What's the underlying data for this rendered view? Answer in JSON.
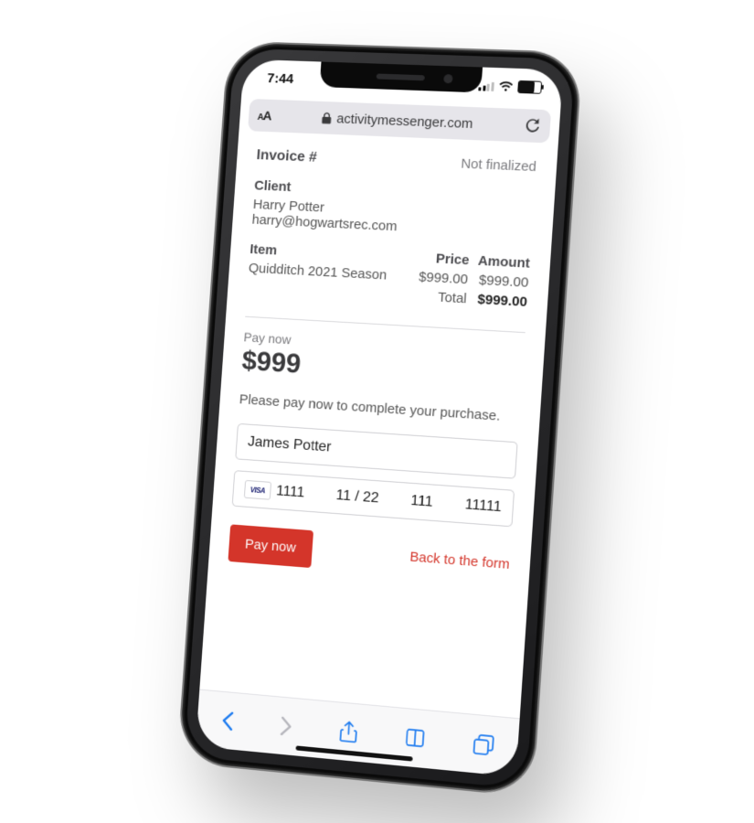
{
  "status": {
    "time": "7:44"
  },
  "browser": {
    "url": "activitymessenger.com"
  },
  "invoice": {
    "title": "Invoice #",
    "status": "Not finalized",
    "client_label": "Client",
    "client_name": "Harry Potter",
    "client_email": "harry@hogwartsrec.com",
    "columns": {
      "item": "Item",
      "price": "Price",
      "amount": "Amount"
    },
    "line_item": {
      "name": "Quidditch 2021 Season",
      "price": "$999.00",
      "amount": "$999.00"
    },
    "total_label": "Total",
    "total_value": "$999.00"
  },
  "payment": {
    "label": "Pay now",
    "amount_display": "$999",
    "note": "Please pay now to complete your purchase.",
    "name_value": "James Potter",
    "card_brand": "VISA",
    "card_last": "1111",
    "card_exp": "11 / 22",
    "card_cvc": "111",
    "card_zip": "11111",
    "pay_button": "Pay now",
    "back_link": "Back to the form"
  }
}
